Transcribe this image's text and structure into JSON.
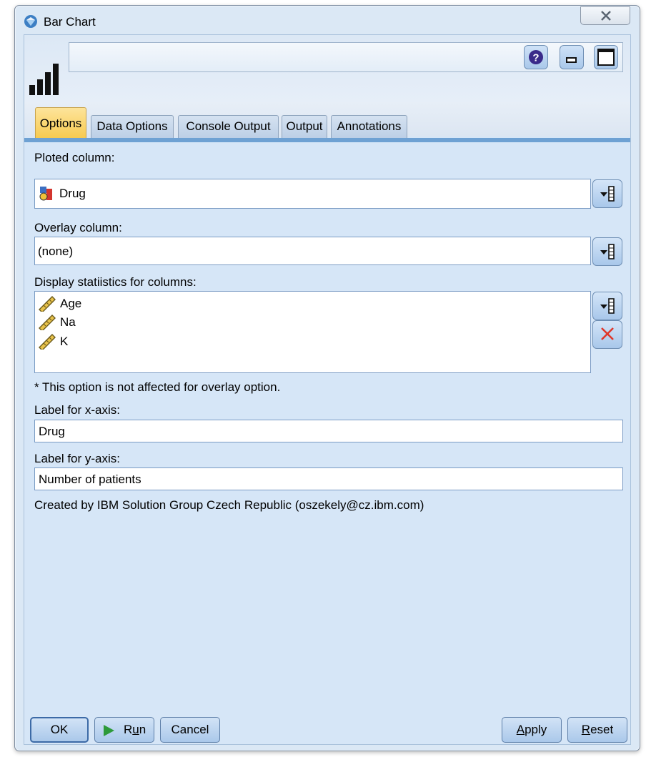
{
  "window": {
    "title": "Bar Chart"
  },
  "tabs": [
    "Options",
    "Data Options",
    "Console Output",
    "Output",
    "Annotations"
  ],
  "fields": {
    "plotted_label": "Ploted column:",
    "plotted_value": "Drug",
    "overlay_label": "Overlay column:",
    "overlay_value": "(none)",
    "stats_label": "Display statiistics for columns:",
    "stats_items": [
      "Age",
      "Na",
      "K"
    ],
    "note": "* This option is not affected for overlay option.",
    "xlabel_label": "Label for x-axis:",
    "xlabel_value": "Drug",
    "ylabel_label": "Label for y-axis:",
    "ylabel_value": "Number of patients",
    "credit": "Created by IBM Solution Group Czech Republic (oszekely@cz.ibm.com)"
  },
  "buttons": {
    "ok": "OK",
    "run_prefix": "R",
    "run_underlined": "u",
    "run_suffix": "n",
    "cancel": "Cancel",
    "apply_underlined": "A",
    "apply_suffix": "pply",
    "reset_underlined": "R",
    "reset_suffix": "eset"
  },
  "icons": {
    "app": "gem-icon",
    "help": "help-icon",
    "minimize": "minimize-icon",
    "maximize": "maximize-icon",
    "close": "close-icon",
    "field_type": "set-type-icon",
    "continuous": "ruler-icon",
    "picker": "field-picker-icon",
    "delete": "delete-icon"
  },
  "colors": {
    "active_tab": "#f7c94d",
    "accent": "#6ea1d3",
    "delete": "#e0382b"
  }
}
